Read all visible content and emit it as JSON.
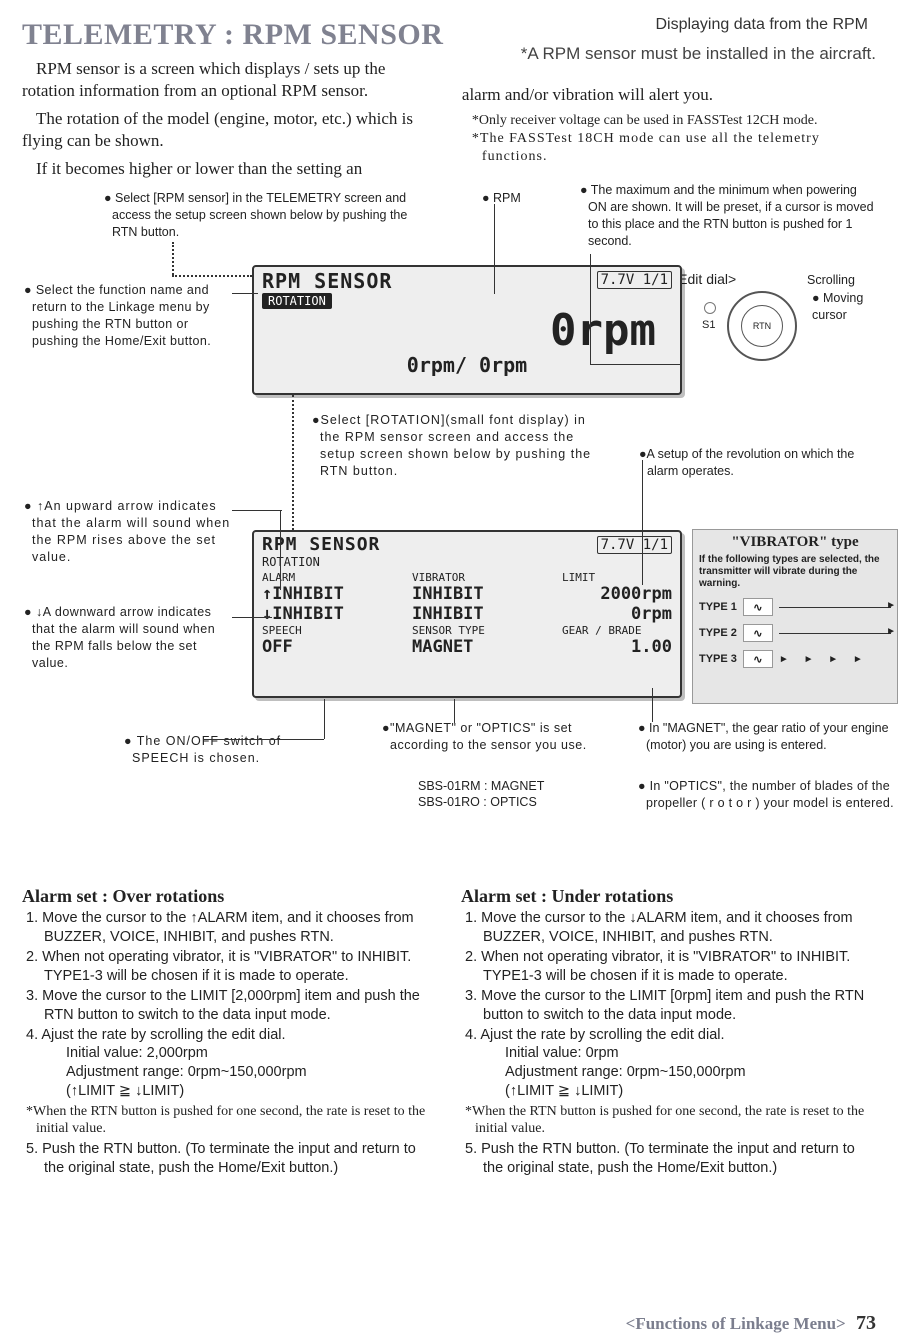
{
  "header": {
    "right_small": "Displaying data from the RPM",
    "title": "TELEMETRY : RPM SENSOR",
    "note_right": "*A RPM sensor must be installed in the aircraft."
  },
  "intro": {
    "p1": "RPM sensor is a screen which displays / sets up the rotation information from an optional RPM sensor.",
    "p2": "The rotation of the model (engine,  motor, etc.) which is flying can be shown.",
    "p3": "If it becomes higher or lower than the setting  an",
    "r1": "alarm and/or vibration will alert you.",
    "r2": "*Only receiver voltage can be used in FASSTest 12CH mode.",
    "r3": "*The FASSTest 18CH mode can use all the telemetry functions."
  },
  "callouts": {
    "c_select_sensor": "● Select [RPM sensor] in the TELEMETRY screen and access the setup screen shown below by pushing the RTN button.",
    "c_rpm": "● RPM",
    "c_maxmin": "● The maximum and the minimum when powering ON are shown. It will be preset, if a cursor is moved to this place and the RTN button is pushed for 1 second.",
    "edit_dial": "<Edit dial>",
    "scrolling": "Scrolling",
    "moving_cursor": "● Moving cursor",
    "s1": "S1",
    "c_func": "● Select the function name and return to the Linkage menu by pushing the RTN button or pushing the Home/Exit button.",
    "c_rotation": "●Select [ROTATION](small font display) in the RPM sensor screen and access the setup screen shown below by pushing the RTN button.",
    "c_setup_rev": "●A setup of the revolution on which the alarm operates.",
    "c_up": "● ↑An upward arrow indicates that the alarm will sound when the RPM rises above the set value.",
    "c_dn": "● ↓A downward arrow indicates that the alarm will sound when the RPM falls below the set value.",
    "c_speech": "● The ON/OFF switch of SPEECH is chosen.",
    "c_magnet": "●\"MAGNET\" or \"OPTICS\" is set according to the sensor you use.",
    "c_sbs1": "SBS-01RM : MAGNET",
    "c_sbs2": "SBS-01RO : OPTICS",
    "c_magnet_gear": "● In \"MAGNET\", the gear ratio of your engine (motor) you are using is entered.",
    "c_optics_blade": "● In \"OPTICS\", the number of blades of the propeller ( r o t o r ) your model is entered."
  },
  "lcd1": {
    "title": "RPM SENSOR",
    "tag": "ROTATION",
    "batt": "7.7V 1/1",
    "big": "0rpm",
    "sub": "0rpm/         0rpm"
  },
  "lcd2": {
    "title": "RPM SENSOR",
    "tag": "ROTATION",
    "batt": "7.7V 1/1",
    "h_alarm": "ALARM",
    "h_vib": "VIBRATOR",
    "h_limit": "LIMIT",
    "v_up": "↑INHIBIT",
    "v_up2": "INHIBIT",
    "v_uplim": "2000rpm",
    "v_dn": "↓INHIBIT",
    "v_dn2": "INHIBIT",
    "v_dnlim": "0rpm",
    "h_speech": "SPEECH",
    "h_stype": "SENSOR TYPE",
    "h_gear": "GEAR / BRADE",
    "v_speech": "OFF",
    "v_stype": "MAGNET",
    "v_gear": "1.00"
  },
  "vibbox": {
    "title": "\"VIBRATOR\" type",
    "sub": "If the following types are selected, the transmitter will vibrate during the warning.",
    "t1": "TYPE 1",
    "t2": "TYPE 2",
    "t3": "TYPE 3"
  },
  "over": {
    "title": "Alarm set : Over rotations",
    "s1": "1. Move the cursor to the ↑ALARM  item, and it chooses from BUZZER, VOICE, INHIBIT, and pushes RTN.",
    "s2": "2. When not operating vibrator, it is \"VIBRATOR\" to INHIBIT. TYPE1-3 will be chosen if it is made to operate.",
    "s3": "3. Move the cursor to the LIMIT [2,000rpm] item and push the RTN button to switch to the data input mode.",
    "s4": "4. Ajust the rate by scrolling the edit dial.",
    "s4a": "Initial value: 2,000rpm",
    "s4b": "Adjustment range: 0rpm~150,000rpm",
    "s4c": "(↑LIMIT ≧ ↓LIMIT)",
    "star": "*When the RTN button is pushed for one second, the rate is reset to the initial value.",
    "s5": "5. Push the RTN button. (To terminate the input and return to the original state, push the Home/Exit button.)"
  },
  "under": {
    "title": "Alarm set : Under rotations",
    "s1": "1. Move the cursor to the ↓ALARM  item, and it chooses from BUZZER, VOICE, INHIBIT, and pushes RTN.",
    "s2": "2. When not operating vibrator, it is \"VIBRATOR\" to INHIBIT. TYPE1-3 will be chosen if it is made to operate.",
    "s3": "3. Move the cursor to the LIMIT [0rpm] item and push the RTN button to switch to the data input mode.",
    "s4": "4. Ajust the rate by scrolling the edit dial.",
    "s4a": "Initial value: 0rpm",
    "s4b": "Adjustment range: 0rpm~150,000rpm",
    "s4c": "(↑LIMIT ≧ ↓LIMIT)",
    "star": "*When the RTN button is pushed for one second, the rate is reset to the initial value.",
    "s5": "5. Push the RTN button. (To terminate the input and return to the original state, push the Home/Exit button.)"
  },
  "footer": {
    "menu": "<Functions of Linkage Menu>",
    "page": "73"
  }
}
